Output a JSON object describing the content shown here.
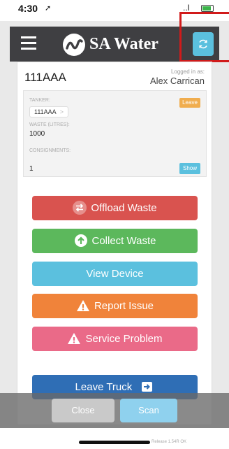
{
  "status_bar": {
    "time": "4:30",
    "arrow": "➚",
    "signal": "..l"
  },
  "header": {
    "logo_text": "SA Water"
  },
  "truck": {
    "id": "111AAA",
    "logged_in_label": "Logged in as:",
    "user": "Alex Carrican"
  },
  "info": {
    "tanker_label": "TANKER:",
    "tanker_value": "111AAA",
    "tanker_chevron": ">",
    "leave_label": "Leave",
    "waste_label": "WASTE (LITRES):",
    "waste_value": "1000",
    "consignments_label": "CONSIGNMENTS:",
    "consignments_value": "1",
    "show_label": "Show"
  },
  "actions": {
    "offload": "Offload Waste",
    "collect": "Collect Waste",
    "view": "View Device",
    "report": "Report Issue",
    "service": "Service Problem",
    "leave": "Leave Truck"
  },
  "bottom": {
    "close": "Close",
    "scan": "Scan"
  },
  "release": "Release 1.54R OK",
  "colors": {
    "header_bg": "#3f3f42",
    "offload": "#d9534f",
    "collect": "#5cb85c",
    "view": "#5bc0de",
    "report": "#f0833a",
    "service": "#ea6a88",
    "leave": "#2f6eb5",
    "highlight": "#d11a1a"
  }
}
